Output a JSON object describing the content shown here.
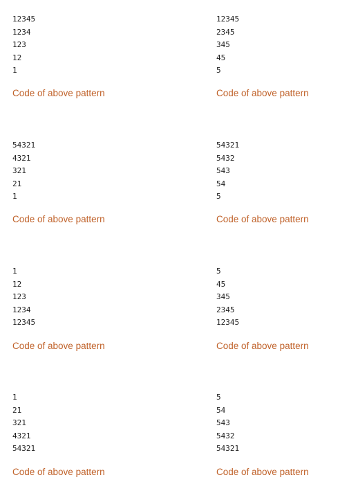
{
  "link_color": "#c0622a",
  "blocks": [
    {
      "lines": [
        "12345",
        "1234",
        "123",
        "12",
        "1"
      ],
      "link": "Code of above pattern"
    },
    {
      "lines": [
        "12345",
        "2345",
        "345",
        "45",
        "5"
      ],
      "link": "Code of above pattern"
    },
    {
      "lines": [
        "54321",
        "4321",
        "321",
        "21",
        "1"
      ],
      "link": "Code of above pattern"
    },
    {
      "lines": [
        "54321",
        "5432",
        "543",
        "54",
        "5"
      ],
      "link": "Code of above pattern"
    },
    {
      "lines": [
        "1",
        "12",
        "123",
        "1234",
        "12345"
      ],
      "link": "Code of above pattern"
    },
    {
      "lines": [
        "5",
        "45",
        "345",
        "2345",
        "12345"
      ],
      "link": "Code of above pattern"
    },
    {
      "lines": [
        "1",
        "21",
        "321",
        "4321",
        "54321"
      ],
      "link": "Code of above pattern"
    },
    {
      "lines": [
        "5",
        "54",
        "543",
        "5432",
        "54321"
      ],
      "link": "Code of above pattern"
    }
  ]
}
